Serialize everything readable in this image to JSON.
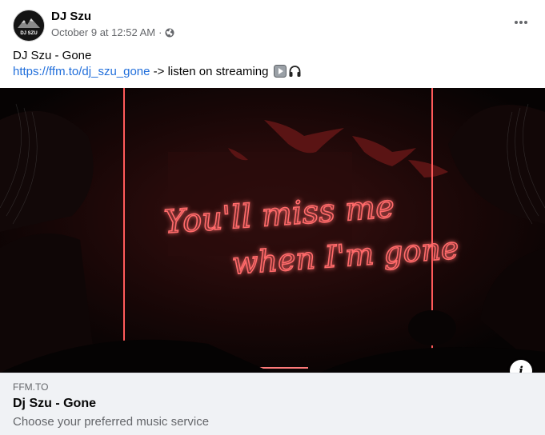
{
  "post": {
    "author": "DJ Szu",
    "avatar_text": "DJ SZU",
    "timestamp": "October 9 at 12:52 AM",
    "separator": "·",
    "audience_icon": "globe-icon",
    "more_icon": "more-options-icon"
  },
  "body": {
    "line1": "DJ Szu - Gone",
    "link_text": "https://ffm.to/dj_szu_gone",
    "after_link": " -> listen on streaming ",
    "emojis": [
      "play-button-icon",
      "headphone-icon"
    ]
  },
  "image": {
    "neon_line1": "You'll miss me",
    "neon_line2": "when I'm gone",
    "neon_color": "#ff3a3a"
  },
  "link_preview": {
    "domain": "FFM.TO",
    "title": "Dj Szu - Gone",
    "description": "Choose your preferred music service",
    "info_icon": "info-icon"
  }
}
